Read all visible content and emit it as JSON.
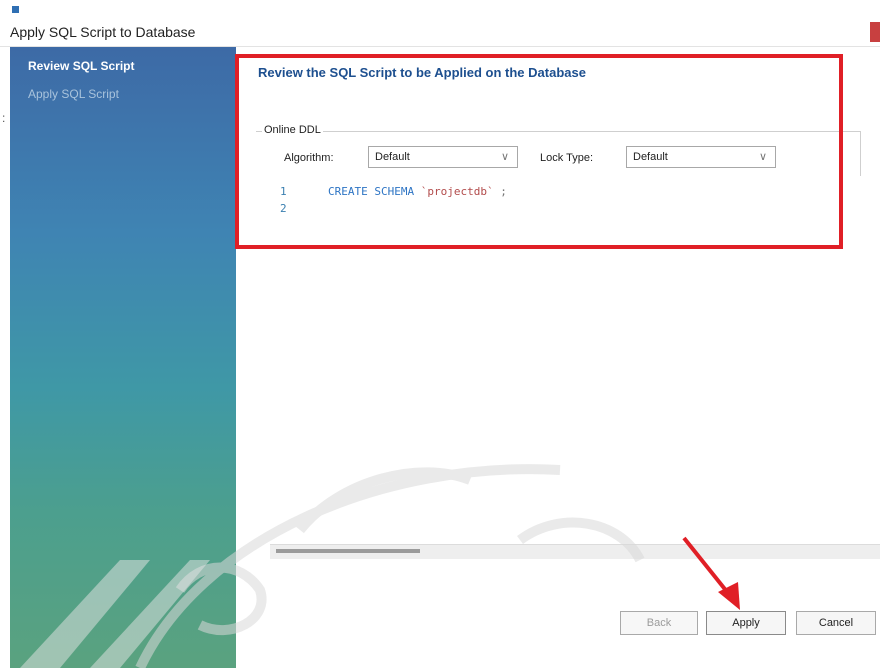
{
  "window": {
    "title": "Apply SQL Script to Database"
  },
  "sidebar": {
    "steps": [
      {
        "label": "Review SQL Script",
        "active": true
      },
      {
        "label": "Apply SQL Script",
        "active": false
      }
    ]
  },
  "main": {
    "heading": "Review the SQL Script to be Applied on the Database",
    "online_ddl": {
      "legend": "Online DDL",
      "algorithm_label": "Algorithm:",
      "algorithm_value": "Default",
      "lock_type_label": "Lock Type:",
      "lock_type_value": "Default"
    },
    "script_lines": [
      {
        "number": "1",
        "keyword": "CREATE SCHEMA",
        "identifier": "`projectdb`",
        "terminator": ";"
      },
      {
        "number": "2",
        "keyword": "",
        "identifier": "",
        "terminator": ""
      }
    ]
  },
  "buttons": {
    "back": "Back",
    "apply": "Apply",
    "cancel": "Cancel"
  },
  "colors": {
    "highlight_box": "#e01f26",
    "heading": "#1d4f8f",
    "keyword": "#2d74c4",
    "string": "#b24b4b"
  },
  "icons": {
    "chevron": "chevron-down-icon",
    "arrow": "red-arrow-annotation"
  }
}
